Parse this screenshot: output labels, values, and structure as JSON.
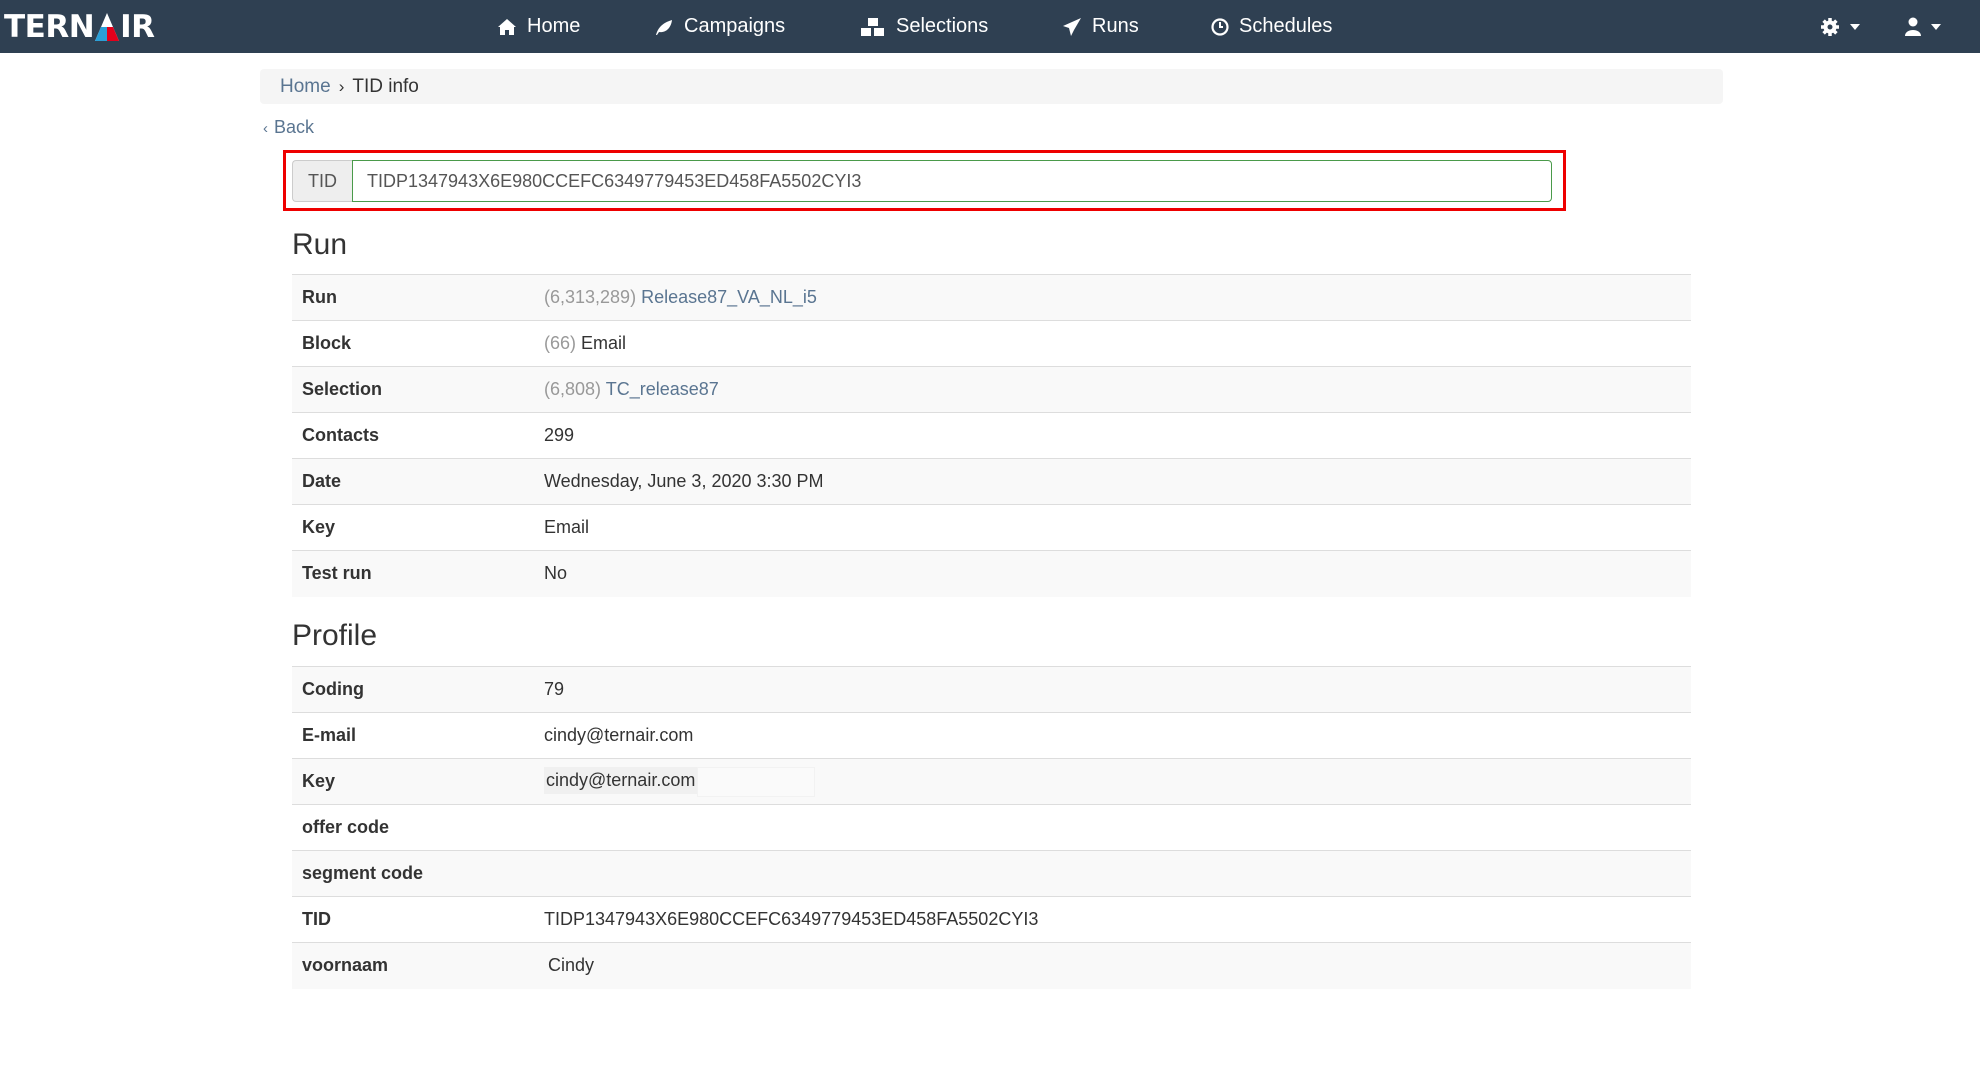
{
  "brand": {
    "logo_text": "TERNAIR",
    "accent_blue": "#2a9fd8",
    "accent_red": "#e3001b",
    "nav_bg": "#2f4052"
  },
  "nav": {
    "items": [
      {
        "label": "Home",
        "icon": "home-icon"
      },
      {
        "label": "Campaigns",
        "icon": "leaf-icon"
      },
      {
        "label": "Selections",
        "icon": "cubes-icon"
      },
      {
        "label": "Runs",
        "icon": "paper-plane-icon"
      },
      {
        "label": "Schedules",
        "icon": "clock-icon"
      }
    ],
    "settings_icon": "gear-icon",
    "user_icon": "user-icon"
  },
  "breadcrumb": {
    "home": "Home",
    "sep": "›",
    "current": "TID info"
  },
  "back": {
    "icon": "‹",
    "label": "Back"
  },
  "tid_search": {
    "label": "TID",
    "value": "TIDP1347943X6E980CCEFC6349779453ED458FA5502CYI3"
  },
  "run": {
    "heading": "Run",
    "rows": [
      {
        "label": "Run",
        "id": "(6,313,289)",
        "value": "Release87_VA_NL_i5"
      },
      {
        "label": "Block",
        "id": "(66)",
        "value": "Email"
      },
      {
        "label": "Selection",
        "id": "(6,808)",
        "value": "TC_release87"
      },
      {
        "label": "Contacts",
        "value": "299"
      },
      {
        "label": "Date",
        "value": "Wednesday, June 3, 2020 3:30 PM"
      },
      {
        "label": "Key",
        "value": "Email"
      },
      {
        "label": "Test run",
        "value": "No"
      }
    ]
  },
  "profile": {
    "heading": "Profile",
    "rows": [
      {
        "label": "Coding",
        "value": "79"
      },
      {
        "label": "E-mail",
        "value": "cindy@ternair.com"
      },
      {
        "label": "Key",
        "value": "cindy@ternair.com"
      },
      {
        "label": "offer code",
        "value": ""
      },
      {
        "label": "segment code",
        "value": ""
      },
      {
        "label": "TID",
        "value": "TIDP1347943X6E980CCEFC6349779453ED458FA5502CYI3"
      },
      {
        "label": "voornaam",
        "value": "Cindy"
      }
    ]
  }
}
